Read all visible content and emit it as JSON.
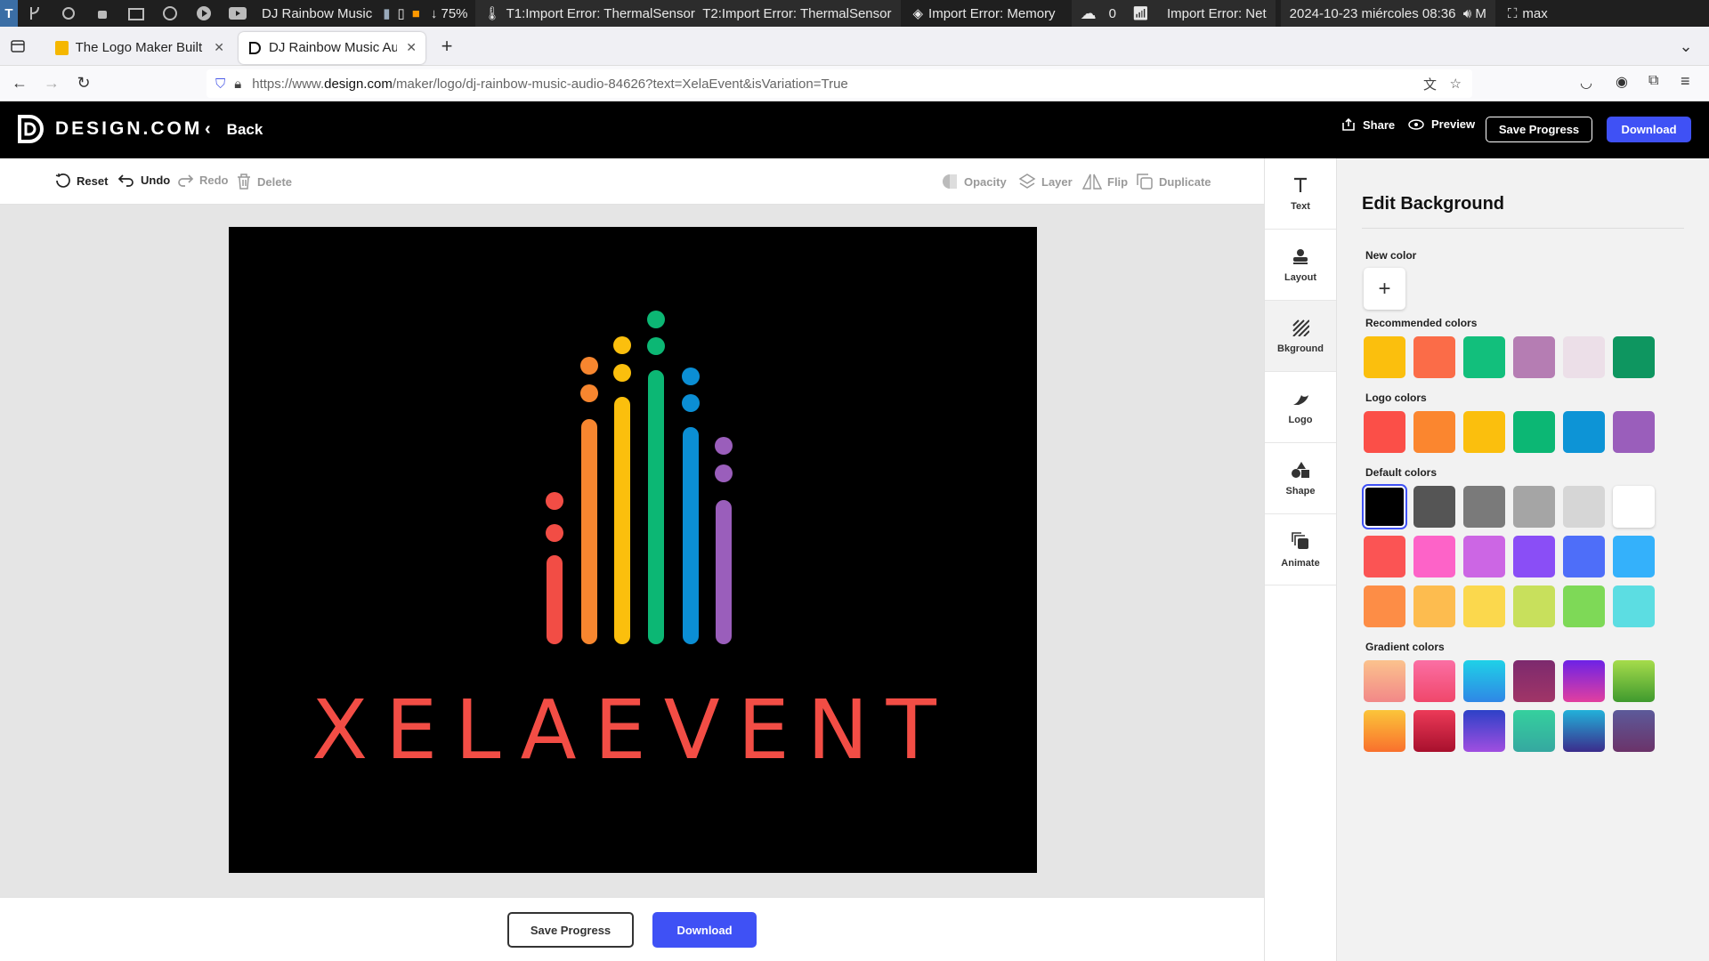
{
  "os_bar": {
    "window_title": "DJ Rainbow Music",
    "battery": "↓ 75%",
    "t1": "T1:Import Error: ThermalSensor",
    "t2": "T2:Import Error: ThermalSensor",
    "memory": "Import Error: Memory",
    "cloud_count": "0",
    "net": "Import Error: Net",
    "datetime": "2024-10-23 miércoles 08:36",
    "volume_label": "M",
    "layout": "max"
  },
  "browser": {
    "tabs": [
      {
        "label": "The Logo Maker Built for"
      },
      {
        "label": "DJ Rainbow Music Audio L"
      }
    ],
    "url_prefix": "https://www.",
    "url_domain": "design.com",
    "url_path": "/maker/logo/dj-rainbow-music-audio-84626?text=XelaEvent&isVariation=True"
  },
  "header": {
    "logo_text": "DESIGN.COM",
    "back_label": "Back",
    "share_label": "Share",
    "preview_label": "Preview",
    "save_label": "Save Progress",
    "download_label": "Download"
  },
  "toolbar": {
    "reset": "Reset",
    "undo": "Undo",
    "redo": "Redo",
    "delete": "Delete",
    "opacity": "Opacity",
    "layer": "Layer",
    "flip": "Flip",
    "duplicate": "Duplicate"
  },
  "logo_design": {
    "text": "XELAEVENT",
    "text_color": "#f24d45",
    "background": "#000000",
    "bar_colors": [
      "#f24d45",
      "#f7862f",
      "#fbbf0d",
      "#0cb774",
      "#0b8ed4",
      "#9a5ebb"
    ]
  },
  "side_tools": [
    {
      "label": "Text",
      "icon": "text-icon"
    },
    {
      "label": "Layout",
      "icon": "layout-icon"
    },
    {
      "label": "Bkground",
      "icon": "background-icon"
    },
    {
      "label": "Logo",
      "icon": "logo-icon"
    },
    {
      "label": "Shape",
      "icon": "shape-icon"
    },
    {
      "label": "Animate",
      "icon": "animate-icon"
    }
  ],
  "panel": {
    "title": "Edit Background",
    "new_color_label": "New color",
    "recommended_label": "Recommended colors",
    "logo_colors_label": "Logo colors",
    "default_label": "Default colors",
    "gradient_label": "Gradient colors",
    "recommended": [
      "#fbbf0d",
      "#fb6c48",
      "#12bf7c",
      "#b57db3",
      "#ecdfe8",
      "#0e9660"
    ],
    "logo_colors": [
      "#fb4f48",
      "#fb862f",
      "#fbbf0d",
      "#0cb774",
      "#0d94d6",
      "#9a5ebb"
    ],
    "default_row1": [
      "#000000",
      "#555555",
      "#7a7a7a",
      "#a5a5a5",
      "#d6d6d6",
      "#ffffff"
    ],
    "default_row2": [
      "#fb5454",
      "#fd63c8",
      "#cc66e4",
      "#8a4ef6",
      "#4e6ef9",
      "#34b1fb"
    ],
    "default_row3": [
      "#fd8d46",
      "#fdbc4f",
      "#fbd84d",
      "#c8e05c",
      "#7ed957",
      "#5cdde2"
    ],
    "gradient_row1": [
      [
        "#fbc28d",
        "#f28888"
      ],
      [
        "#fb6fa4",
        "#f0476b"
      ],
      [
        "#1fd1e7",
        "#2f87e6"
      ],
      [
        "#7c2a6e",
        "#a13567"
      ],
      [
        "#6d22e6",
        "#e23f9f"
      ],
      [
        "#a6dc4b",
        "#3f9a2e"
      ]
    ],
    "gradient_row2": [
      [
        "#fbc53a",
        "#f9702d"
      ],
      [
        "#ec3a58",
        "#a8102d"
      ],
      [
        "#2d41c7",
        "#a04ee0"
      ],
      [
        "#35d09e",
        "#35a8a0"
      ],
      [
        "#22b1d9",
        "#3b2c8c"
      ],
      [
        "#5c5a9a",
        "#6b3369"
      ]
    ]
  },
  "bottom": {
    "save_label": "Save Progress",
    "download_label": "Download"
  }
}
